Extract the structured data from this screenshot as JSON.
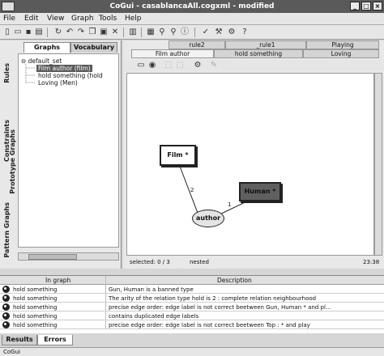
{
  "window": {
    "title": "CoGui - casablancaAll.cogxml - modified",
    "minimize": "_",
    "maximize": "□",
    "close": "×"
  },
  "menu": [
    "File",
    "Edit",
    "View",
    "Graph",
    "Tools",
    "Help"
  ],
  "toolbar": {
    "icons": [
      "new-file-icon",
      "open-folder-icon",
      "save-icon",
      "print-icon",
      "refresh-icon",
      "undo-icon",
      "redo-icon",
      "copy-icon",
      "paste-icon",
      "delete-icon",
      "layout-icon",
      "grid-icon",
      "zoom-icon",
      "search-icon",
      "info-icon",
      "check-icon",
      "tools-icon",
      "settings-icon",
      "help-icon"
    ]
  },
  "left": {
    "side_tabs": [
      "Rules",
      "Constraints",
      "Prototype Graphs",
      "Pattern Graphs"
    ],
    "tabs": [
      "Graphs",
      "Vocabulary"
    ],
    "active_tab": "Graphs",
    "tree": {
      "root": "default_set",
      "items": [
        "Film author (film)",
        "hold something (hold",
        "Loving (Men)"
      ],
      "selected_index": 0
    }
  },
  "graph_tabs": {
    "row1": [
      "rule2",
      "_rule1",
      "Playing"
    ],
    "row2": [
      "Film author",
      "hold something",
      "Loving"
    ],
    "active": "Film author"
  },
  "graph": {
    "concepts": [
      {
        "id": "film",
        "label": "Film *",
        "fill": "#ffffff"
      },
      {
        "id": "human",
        "label": "Human *",
        "fill": "#5f5f5f"
      }
    ],
    "relation": {
      "label": "author"
    },
    "edges": [
      {
        "from": "author",
        "to": "film",
        "label": "2"
      },
      {
        "from": "author",
        "to": "human",
        "label": "1"
      }
    ]
  },
  "status": {
    "selected": "selected: 0 / 3",
    "mode": "nested",
    "position": "23:38"
  },
  "errors": {
    "columns": [
      "In graph",
      "Description"
    ],
    "rows": [
      {
        "graph": "hold something",
        "description": "Gun, Human is a banned type"
      },
      {
        "graph": "hold something",
        "description": "The arity of the relation type hold is 2 : complete relation neighbourhood"
      },
      {
        "graph": "hold something",
        "description": "precise edge order: edge label is not correct beetween Gun, Human * and pl..."
      },
      {
        "graph": "hold something",
        "description": "contains duplicated edge labels"
      },
      {
        "graph": "hold something",
        "description": "precise edge order: edge label is not correct beetween Top : * and play"
      }
    ]
  },
  "bottom_tabs": [
    "Results",
    "Errors"
  ],
  "active_bottom_tab": "Errors",
  "app_status": "CoGui"
}
